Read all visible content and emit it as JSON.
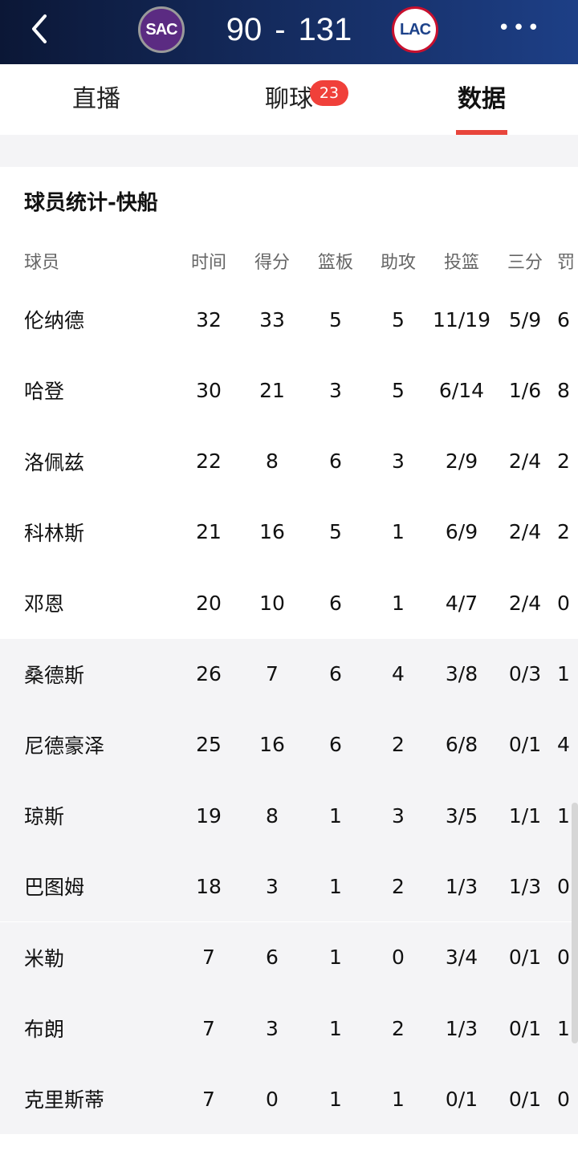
{
  "header": {
    "home_team": "SAC",
    "away_team": "LAC",
    "home_score": "90",
    "separator": "-",
    "away_score": "131",
    "more_label": "•••"
  },
  "tabs": [
    {
      "label": "直播",
      "active": false
    },
    {
      "label": "聊球",
      "active": false,
      "badge": "23"
    },
    {
      "label": "数据",
      "active": true
    }
  ],
  "section": {
    "title": "球员统计-快船"
  },
  "table": {
    "headers": [
      "球员",
      "时间",
      "得分",
      "篮板",
      "助攻",
      "投篮",
      "三分",
      "罚"
    ],
    "starters": [
      [
        "伦纳德",
        "32",
        "33",
        "5",
        "5",
        "11/19",
        "5/9",
        "6"
      ],
      [
        "哈登",
        "30",
        "21",
        "3",
        "5",
        "6/14",
        "1/6",
        "8"
      ],
      [
        "洛佩兹",
        "22",
        "8",
        "6",
        "3",
        "2/9",
        "2/4",
        "2"
      ],
      [
        "科林斯",
        "21",
        "16",
        "5",
        "1",
        "6/9",
        "2/4",
        "2"
      ],
      [
        "邓恩",
        "20",
        "10",
        "6",
        "1",
        "4/7",
        "2/4",
        "0"
      ]
    ],
    "bench": [
      [
        "桑德斯",
        "26",
        "7",
        "6",
        "4",
        "3/8",
        "0/3",
        "1"
      ],
      [
        "尼德豪泽",
        "25",
        "16",
        "6",
        "2",
        "6/8",
        "0/1",
        "4"
      ],
      [
        "琼斯",
        "19",
        "8",
        "1",
        "3",
        "3/5",
        "1/1",
        "1"
      ],
      [
        "巴图姆",
        "18",
        "3",
        "1",
        "2",
        "1/3",
        "1/3",
        "0"
      ],
      [
        "米勒",
        "7",
        "6",
        "1",
        "0",
        "3/4",
        "0/1",
        "0"
      ],
      [
        "布朗",
        "7",
        "3",
        "1",
        "2",
        "1/3",
        "0/1",
        "1"
      ],
      [
        "克里斯蒂",
        "7",
        "0",
        "1",
        "1",
        "0/1",
        "0/1",
        "0"
      ]
    ]
  },
  "colors": {
    "accent": "#e8453c",
    "badge": "#f0403a",
    "header_bg": "#142a5c"
  }
}
